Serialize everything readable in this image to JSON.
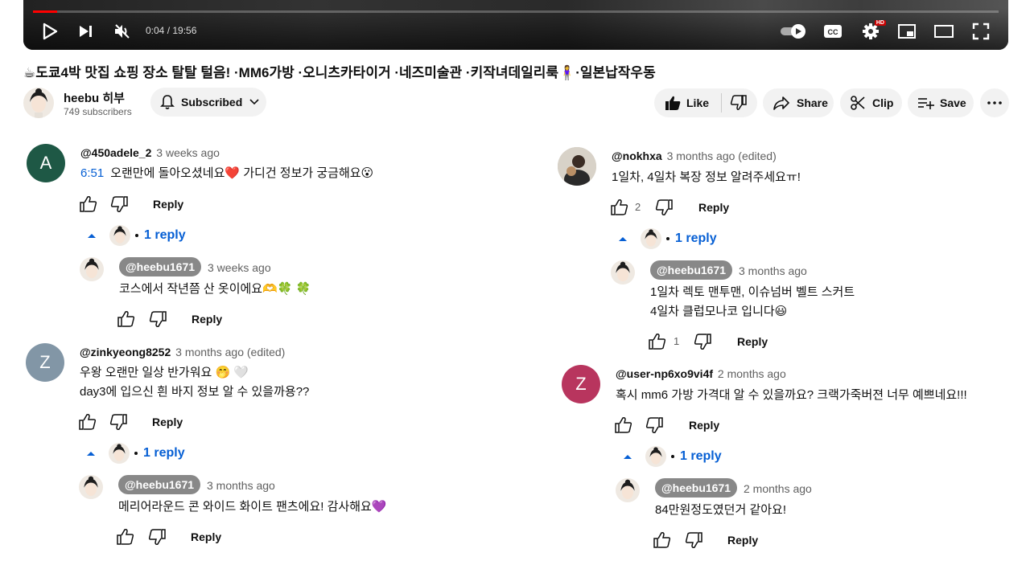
{
  "player": {
    "time": "0:04 / 19:56",
    "played_fraction": 0.003,
    "hd_badge": "HD",
    "icons": [
      "play-icon",
      "next-icon",
      "mute-icon",
      "autoplay-toggle-icon",
      "captions-icon",
      "settings-icon",
      "miniplayer-icon",
      "theater-icon",
      "fullscreen-icon"
    ]
  },
  "video": {
    "title": "☕도쿄4박 맛집 쇼핑 장소 탈탈 털음! ·MM6가방 ·오니츠카타이거 ·네즈미술관 ·키작녀데일리룩🧍‍♀️·일본납작우동"
  },
  "channel": {
    "name": "heebu 히부",
    "subscribers": "749 subscribers",
    "subscribe_label": "Subscribed"
  },
  "actions": {
    "like_label": "Like",
    "share_label": "Share",
    "clip_label": "Clip",
    "save_label": "Save"
  },
  "colors": {
    "accent_link": "#065fd4",
    "avatar_a": "#1e5845",
    "avatar_z1": "#8296a6",
    "avatar_z2": "#b8355e",
    "owner_chip": "#888888"
  },
  "comments": [
    {
      "avatar_letter": "A",
      "handle": "@450adele_2",
      "ago": "3 weeks ago",
      "timestamp_link": "6:51",
      "text": "오랜만에 돌아오셨네요❤️ 가디건 정보가 궁금해요😮",
      "reply_label": "Reply",
      "replies_toggle": "1 reply",
      "reply": {
        "handle": "@heebu1671",
        "ago": "3 weeks ago",
        "text": "코스에서 작년쯤 산 옷이에요🫶🍀 🍀",
        "reply_label": "Reply"
      }
    },
    {
      "avatar_letter": "Z",
      "handle": "@zinkyeong8252",
      "ago": "3 months ago (edited)",
      "lines": [
        "우왕 오랜만 일상 반가워요 🤭 🤍",
        "day3에 입으신 흰 바지 정보 알 수 있을까용??"
      ],
      "reply_label": "Reply",
      "replies_toggle": "1 reply",
      "reply": {
        "handle": "@heebu1671",
        "ago": "3 months ago",
        "text": "메리어라운드 콘 와이드 화이트 팬츠에요! 감사해요💜",
        "reply_label": "Reply"
      }
    },
    {
      "handle": "@nokhxa",
      "ago": "3 months ago (edited)",
      "text": "1일차, 4일차 복장 정보 알려주세요ㅠ!",
      "like_count": "2",
      "reply_label": "Reply",
      "replies_toggle": "1 reply",
      "reply": {
        "handle": "@heebu1671",
        "ago": "3 months ago",
        "lines": [
          "1일차 렉토 맨투맨, 이슈넘버 벨트 스커트",
          "4일차 클럽모나코 입니다😃"
        ],
        "like_count": "1",
        "reply_label": "Reply"
      }
    },
    {
      "avatar_letter": "Z",
      "handle": "@user-np6xo9vi4f",
      "ago": "2 months ago",
      "text": "혹시 mm6 가방 가격대 알 수 있을까요? 크랙가죽버젼 너무 예쁘네요!!!",
      "reply_label": "Reply",
      "replies_toggle": "1 reply",
      "reply": {
        "handle": "@heebu1671",
        "ago": "2 months ago",
        "text": "84만원정도였던거 같아요!",
        "reply_label": "Reply"
      }
    }
  ]
}
